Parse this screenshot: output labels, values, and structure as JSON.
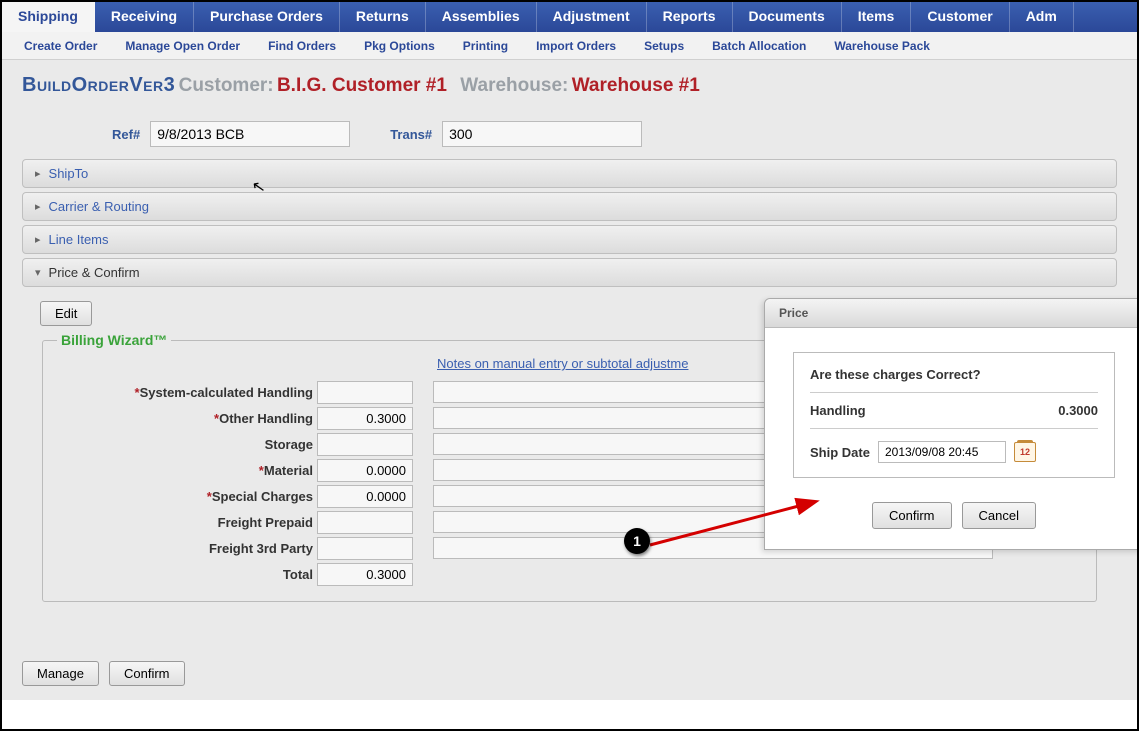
{
  "topnav": [
    "Shipping",
    "Receiving",
    "Purchase Orders",
    "Returns",
    "Assemblies",
    "Adjustment",
    "Reports",
    "Documents",
    "Items",
    "Customer",
    "Adm"
  ],
  "topnav_active": 0,
  "subnav": [
    "Create Order",
    "Manage Open Order",
    "Find Orders",
    "Pkg Options",
    "Printing",
    "Import Orders",
    "Setups",
    "Batch Allocation",
    "Warehouse Pack"
  ],
  "header": {
    "title": "BuildOrderVer3",
    "customer_label": "Customer:",
    "customer_value": "B.I.G. Customer #1",
    "warehouse_label": "Warehouse:",
    "warehouse_value": "Warehouse #1"
  },
  "refs": {
    "ref_label": "Ref#",
    "ref_value": "9/8/2013 BCB",
    "trans_label": "Trans#",
    "trans_value": "300"
  },
  "accordions": {
    "shipto": "ShipTo",
    "carrier": "Carrier & Routing",
    "lineitems": "Line Items",
    "priceconfirm": "Price & Confirm"
  },
  "billing": {
    "edit_label": "Edit",
    "wizard_title": "Billing Wizard™",
    "notes_link": "Notes on manual entry or subtotal adjustme",
    "rows": [
      {
        "label": "System-calculated Handling",
        "req": true,
        "value": "",
        "note": true
      },
      {
        "label": "Other Handling",
        "req": true,
        "value": "0.3000",
        "note": true
      },
      {
        "label": "Storage",
        "req": false,
        "value": "",
        "note": true
      },
      {
        "label": "Material",
        "req": true,
        "value": "0.0000",
        "note": true
      },
      {
        "label": "Special Charges",
        "req": true,
        "value": "0.0000",
        "note": true
      },
      {
        "label": "Freight Prepaid",
        "req": false,
        "value": "",
        "note": true
      },
      {
        "label": "Freight 3rd Party",
        "req": false,
        "value": "",
        "note": true
      },
      {
        "label": "Total",
        "req": false,
        "value": "0.3000",
        "note": false
      }
    ]
  },
  "bottom": {
    "manage": "Manage",
    "confirm": "Confirm"
  },
  "popup": {
    "title": "Price",
    "question": "Are these charges Correct?",
    "charge_label": "Handling",
    "charge_value": "0.3000",
    "shipdate_label": "Ship Date",
    "shipdate_value": "2013/09/08 20:45",
    "confirm": "Confirm",
    "cancel": "Cancel"
  },
  "annotation": {
    "step": "1"
  }
}
